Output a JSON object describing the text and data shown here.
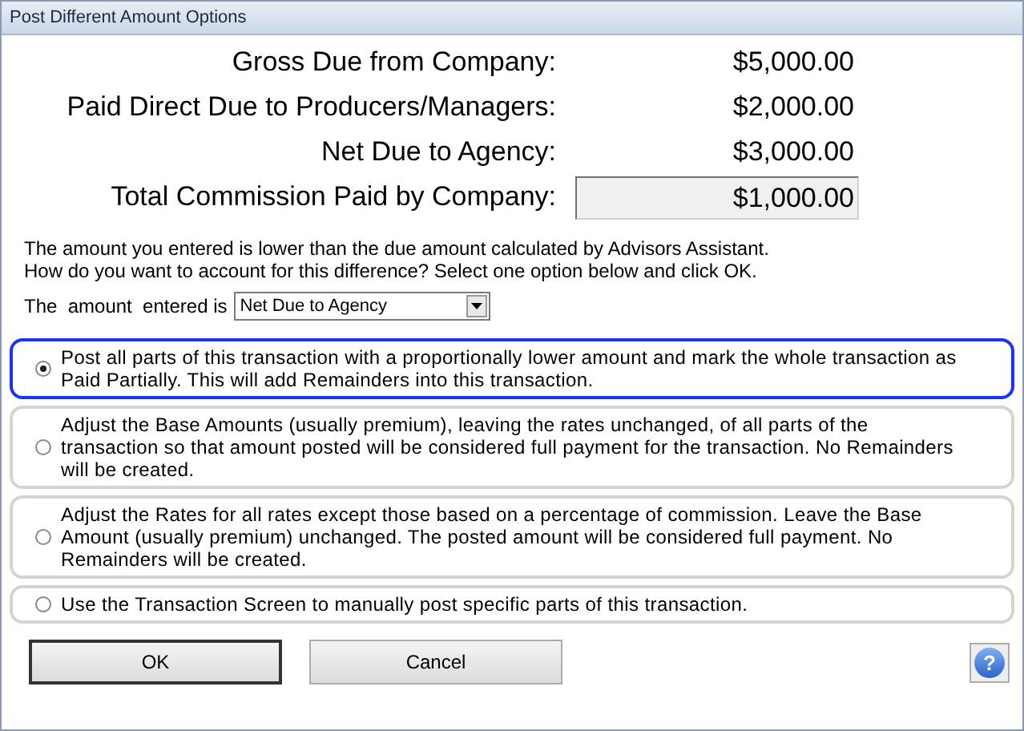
{
  "window": {
    "title": "Post Different Amount Options"
  },
  "summary": [
    {
      "label": "Gross Due from Company:",
      "value": "$5,000.00",
      "kind": "plain"
    },
    {
      "label": "Paid Direct Due to Producers/Managers:",
      "value": "$2,000.00",
      "kind": "plain"
    },
    {
      "label": "Net Due to Agency:",
      "value": "$3,000.00",
      "kind": "plain"
    },
    {
      "label": "Total Commission Paid by Company:",
      "value": "$1,000.00",
      "kind": "field"
    }
  ],
  "message": [
    "The amount you entered is lower than the due amount calculated by Advisors Assistant.",
    "How do you want to account for this difference? Select one option below and click OK."
  ],
  "amount_entered": {
    "label": "The  amount  entered is",
    "value": "Net Due to Agency"
  },
  "options": [
    {
      "text": "Post all parts of this transaction with a proportionally lower amount and mark the whole transaction as Paid Partially.  This will add Remainders into this transaction.",
      "selected": true
    },
    {
      "text": "Adjust the Base Amounts (usually premium), leaving the rates unchanged, of all parts of the transaction so that amount posted will be considered full payment for the transaction. No Remainders will be created.",
      "selected": false
    },
    {
      "text": "Adjust the Rates for all rates except those based on a percentage of commission.  Leave the Base Amount (usually premium) unchanged. The posted amount will be considered full payment. No Remainders will be created.",
      "selected": false
    },
    {
      "text": "Use the Transaction Screen to manually post specific parts of this transaction.",
      "selected": false
    }
  ],
  "buttons": [
    {
      "label": "OK",
      "kind": "default"
    },
    {
      "label": "Cancel",
      "kind": "normal"
    }
  ],
  "help": {
    "label": "?"
  }
}
